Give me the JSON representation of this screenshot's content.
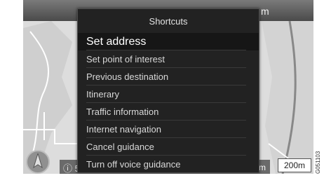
{
  "header": {
    "distance_fragment": "m"
  },
  "menu": {
    "title": "Shortcuts",
    "items": [
      {
        "label": "Set address",
        "selected": true
      },
      {
        "label": "Set point of interest"
      },
      {
        "label": "Previous destination"
      },
      {
        "label": "Itinerary"
      },
      {
        "label": "Traffic information"
      },
      {
        "label": "Internet navigation"
      },
      {
        "label": "Cancel guidance"
      },
      {
        "label": "Turn off voice guidance"
      }
    ]
  },
  "footer": {
    "info_fragment": "ⓘ 5",
    "scale_fragment": "m",
    "scale": "200m"
  },
  "image_code": "G051103",
  "icons": {
    "compass": "compass-icon"
  }
}
